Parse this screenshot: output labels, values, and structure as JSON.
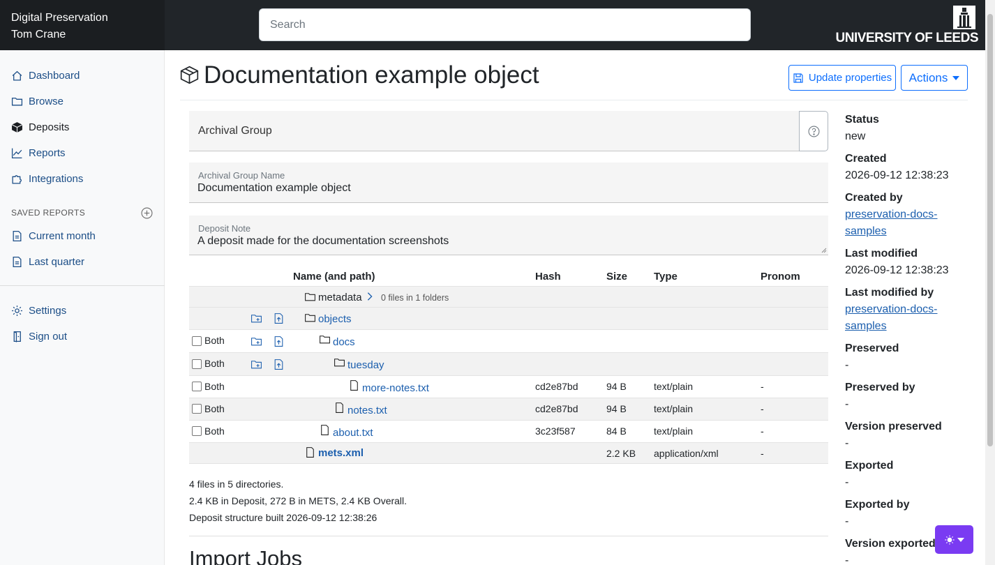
{
  "header": {
    "app_name": "Digital Preservation",
    "user_name": "Tom Crane",
    "search_placeholder": "Search",
    "university": "UNIVERSITY OF LEEDS"
  },
  "sidebar": {
    "items": [
      {
        "label": "Dashboard",
        "icon": "house-icon"
      },
      {
        "label": "Browse",
        "icon": "folder-icon"
      },
      {
        "label": "Deposits",
        "icon": "box-icon",
        "active": true
      },
      {
        "label": "Reports",
        "icon": "graph-icon"
      },
      {
        "label": "Integrations",
        "icon": "puzzle-icon"
      }
    ],
    "saved_reports_heading": "SAVED REPORTS",
    "saved_reports": [
      {
        "label": "Current month"
      },
      {
        "label": "Last quarter"
      }
    ],
    "bottom": [
      {
        "label": "Settings",
        "icon": "gear-icon"
      },
      {
        "label": "Sign out",
        "icon": "signout-icon"
      }
    ]
  },
  "page": {
    "title": "Documentation example object",
    "update_button": "Update properties",
    "actions_button": "Actions"
  },
  "form": {
    "archival_group": "Archival Group",
    "name_label": "Archival Group Name",
    "name_value": "Documentation example object",
    "note_label": "Deposit Note",
    "note_value": "A deposit made for the documentation screenshots"
  },
  "table": {
    "headers": {
      "name": "Name (and path)",
      "hash": "Hash",
      "size": "Size",
      "type": "Type",
      "pronom": "Pronom"
    },
    "metadata": {
      "name": "metadata",
      "info": "0 files in 1 folders"
    },
    "objects": {
      "name": "objects"
    },
    "rows": [
      {
        "check_label": "Both",
        "name": "docs",
        "hash": "",
        "size": "",
        "type": "",
        "pronom": ""
      },
      {
        "check_label": "Both",
        "name": "tuesday",
        "hash": "",
        "size": "",
        "type": "",
        "pronom": ""
      },
      {
        "check_label": "Both",
        "name": "more-notes.txt",
        "hash": "cd2e87bd",
        "size": "94 B",
        "type": "text/plain",
        "pronom": "-"
      },
      {
        "check_label": "Both",
        "name": "notes.txt",
        "hash": "cd2e87bd",
        "size": "94 B",
        "type": "text/plain",
        "pronom": "-"
      },
      {
        "check_label": "Both",
        "name": "about.txt",
        "hash": "3c23f587",
        "size": "84 B",
        "type": "text/plain",
        "pronom": "-"
      }
    ],
    "mets": {
      "name": "mets.xml",
      "size": "2.2 KB",
      "type": "application/xml",
      "pronom": "-"
    }
  },
  "summary": {
    "line1": "4 files in 5 directories.",
    "line2": "2.4 KB in Deposit, 272 B in METS, 2.4 KB Overall.",
    "line3": "Deposit structure built 2026-09-12 12:38:26"
  },
  "import_heading": "Import Jobs",
  "meta": {
    "status_label": "Status",
    "status": "new",
    "created_label": "Created",
    "created": "2026-09-12 12:38:23",
    "created_by_label": "Created by",
    "created_by": "preservation-docs-samples",
    "modified_label": "Last modified",
    "modified": "2026-09-12 12:38:23",
    "modified_by_label": "Last modified by",
    "modified_by": "preservation-docs-samples",
    "preserved_label": "Preserved",
    "preserved": "-",
    "preserved_by_label": "Preserved by",
    "preserved_by": "-",
    "version_preserved_label": "Version preserved",
    "version_preserved": "-",
    "exported_label": "Exported",
    "exported": "-",
    "exported_by_label": "Exported by",
    "exported_by": "-",
    "version_exported_label": "Version exported",
    "version_exported": "-"
  },
  "colors": {
    "topbar": "#212529",
    "link": "#1c5fae",
    "primary": "#0d6efd",
    "theme_button": "#7a3bf2"
  }
}
